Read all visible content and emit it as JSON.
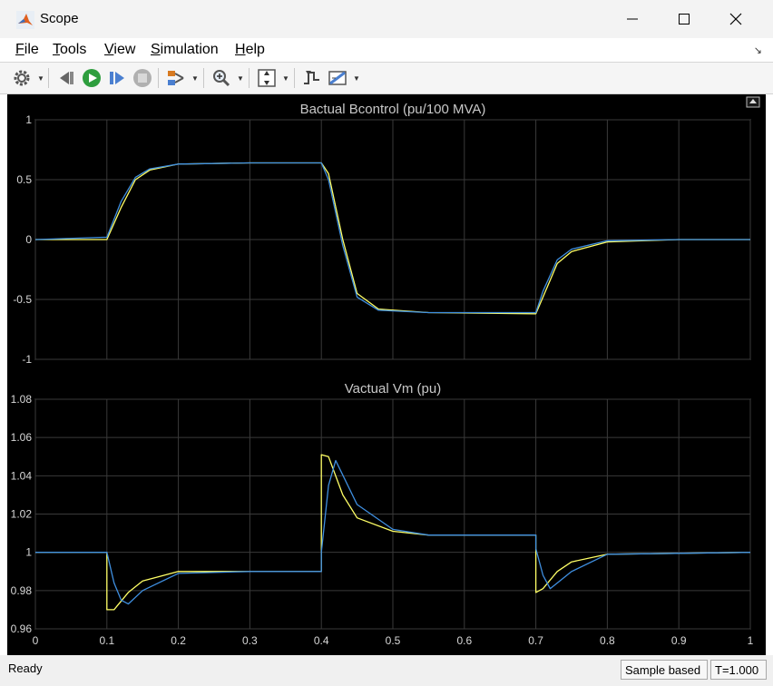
{
  "window": {
    "title": "Scope",
    "icon": "matlab-logo-icon"
  },
  "menu": [
    "File",
    "Tools",
    "View",
    "Simulation",
    "Help"
  ],
  "menu_mnemonics": [
    "F",
    "T",
    "V",
    "S",
    "H"
  ],
  "toolbar_icons": [
    "settings-gear-icon",
    "step-back-icon",
    "run-icon",
    "step-forward-icon",
    "stop-icon",
    "signal-selector-icon",
    "zoom-icon",
    "scale-axes-icon",
    "triggers-icon",
    "measurements-icon"
  ],
  "status": {
    "ready": "Ready",
    "mode": "Sample based",
    "time": "T=1.000"
  },
  "colors": {
    "plot_bg": "#000000",
    "axes_bg": "#000000",
    "grid": "#3a3a3a",
    "series_yellow": "#ffff66",
    "series_blue": "#3f8fe0",
    "title_text": "#c8c8c8"
  },
  "chart_data": [
    {
      "type": "line",
      "title": "Bactual Bcontrol (pu/100 MVA)",
      "xlim": [
        0,
        1
      ],
      "ylim": [
        -1,
        1
      ],
      "xticks": [
        "0",
        "0.1",
        "0.2",
        "0.3",
        "0.4",
        "0.5",
        "0.6",
        "0.7",
        "0.8",
        "0.9",
        "1"
      ],
      "yticks": [
        "1",
        "0.5",
        "0",
        "-0.5",
        "-1"
      ],
      "grid": true,
      "x": [
        0,
        0.1,
        0.12,
        0.14,
        0.16,
        0.2,
        0.3,
        0.4,
        0.41,
        0.43,
        0.45,
        0.48,
        0.55,
        0.7,
        0.71,
        0.73,
        0.75,
        0.8,
        0.9,
        1.0
      ],
      "series": [
        {
          "color": "#ffff66",
          "values": [
            0,
            0,
            0.27,
            0.5,
            0.58,
            0.63,
            0.64,
            0.64,
            0.55,
            0.0,
            -0.45,
            -0.58,
            -0.61,
            -0.62,
            -0.48,
            -0.2,
            -0.1,
            -0.02,
            0,
            0
          ]
        },
        {
          "color": "#3f8fe0",
          "values": [
            0,
            0.02,
            0.32,
            0.52,
            0.59,
            0.63,
            0.64,
            0.64,
            0.5,
            -0.05,
            -0.48,
            -0.59,
            -0.61,
            -0.61,
            -0.43,
            -0.17,
            -0.08,
            -0.01,
            0,
            0
          ]
        }
      ]
    },
    {
      "type": "line",
      "title": "Vactual Vm (pu)",
      "xlim": [
        0,
        1
      ],
      "ylim": [
        0.96,
        1.08
      ],
      "xticks": [
        "0",
        "0.1",
        "0.2",
        "0.3",
        "0.4",
        "0.5",
        "0.6",
        "0.7",
        "0.8",
        "0.9",
        "1"
      ],
      "yticks": [
        "1.08",
        "1.06",
        "1.04",
        "1.02",
        "1",
        "0.98",
        "0.96"
      ],
      "grid": true,
      "series": [
        {
          "color": "#ffff66",
          "x": [
            0,
            0.1,
            0.1,
            0.11,
            0.13,
            0.15,
            0.2,
            0.3,
            0.4,
            0.4,
            0.41,
            0.43,
            0.45,
            0.5,
            0.55,
            0.7,
            0.7,
            0.71,
            0.73,
            0.75,
            0.8,
            1.0
          ],
          "values": [
            1.0,
            1.0,
            0.97,
            0.97,
            0.979,
            0.985,
            0.99,
            0.99,
            0.99,
            1.051,
            1.05,
            1.03,
            1.018,
            1.011,
            1.009,
            1.009,
            0.979,
            0.981,
            0.99,
            0.995,
            0.999,
            1.0
          ]
        },
        {
          "color": "#3f8fe0",
          "x": [
            0,
            0.1,
            0.11,
            0.12,
            0.13,
            0.15,
            0.2,
            0.3,
            0.4,
            0.4,
            0.41,
            0.42,
            0.45,
            0.5,
            0.55,
            0.7,
            0.7,
            0.71,
            0.72,
            0.75,
            0.8,
            1.0
          ],
          "values": [
            1.0,
            1.0,
            0.984,
            0.975,
            0.973,
            0.98,
            0.989,
            0.99,
            0.99,
            1.0,
            1.035,
            1.048,
            1.025,
            1.012,
            1.009,
            1.009,
            1.002,
            0.988,
            0.981,
            0.99,
            0.999,
            1.0
          ]
        }
      ]
    }
  ]
}
